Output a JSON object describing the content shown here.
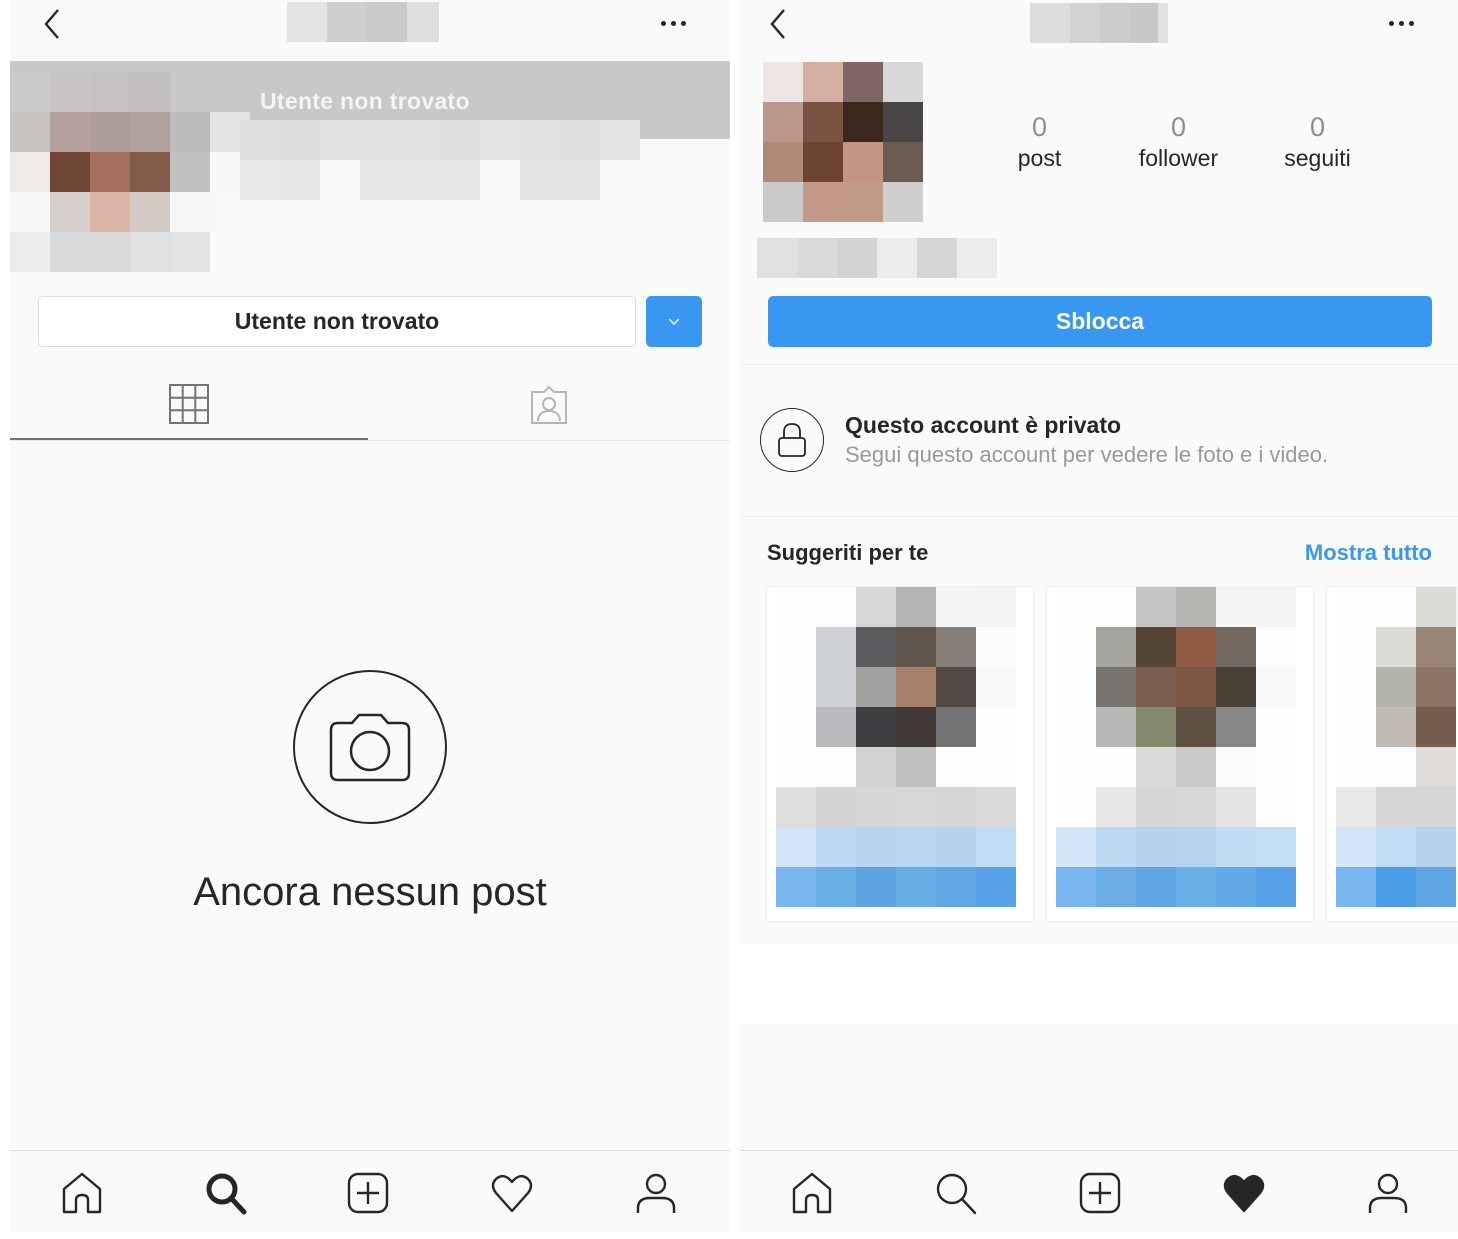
{
  "left_screen": {
    "header": {
      "back_icon": "chevron-left-icon",
      "username": "[pixelated]",
      "more_icon": "more-horizontal-icon"
    },
    "banner_text": "Utente non trovato",
    "action_button_label": "Utente non trovato",
    "dropdown_icon": "chevron-down-icon",
    "tabs": [
      {
        "icon": "grid-icon",
        "active": true
      },
      {
        "icon": "tagged-icon",
        "active": false
      }
    ],
    "empty_state": {
      "icon": "camera-icon",
      "text": "Ancora nessun post"
    },
    "bottom_nav": [
      {
        "icon": "home-icon",
        "active": false
      },
      {
        "icon": "search-icon",
        "active": true
      },
      {
        "icon": "add-post-icon",
        "active": false
      },
      {
        "icon": "heart-icon",
        "active": false
      },
      {
        "icon": "profile-icon",
        "active": false
      }
    ]
  },
  "right_screen": {
    "header": {
      "back_icon": "chevron-left-icon",
      "username": "[pixelated]",
      "more_icon": "more-horizontal-icon"
    },
    "stats": [
      {
        "value": "0",
        "label": "post"
      },
      {
        "value": "0",
        "label": "follower"
      },
      {
        "value": "0",
        "label": "seguiti"
      }
    ],
    "primary_button_label": "Sblocca",
    "private_notice": {
      "icon": "lock-icon",
      "title": "Questo account è privato",
      "subtitle": "Segui questo account per vedere le foto e i video."
    },
    "suggestions": {
      "title": "Suggeriti per te",
      "see_all": "Mostra tutto",
      "cards": [
        {
          "name": "[pixelated]"
        },
        {
          "name": "[pixelated]"
        },
        {
          "name": "[pixelated]"
        }
      ]
    },
    "bottom_nav": [
      {
        "icon": "home-icon",
        "active": false
      },
      {
        "icon": "search-icon",
        "active": false
      },
      {
        "icon": "add-post-icon",
        "active": false
      },
      {
        "icon": "heart-filled-icon",
        "active": true
      },
      {
        "icon": "profile-icon",
        "active": false
      }
    ]
  },
  "colors": {
    "accent_blue": "#3897f0",
    "link_blue": "#3897f0",
    "text_primary": "#262626",
    "text_secondary": "#999999",
    "background": "#fafafa",
    "banner_gray": "#c8c8c8"
  }
}
